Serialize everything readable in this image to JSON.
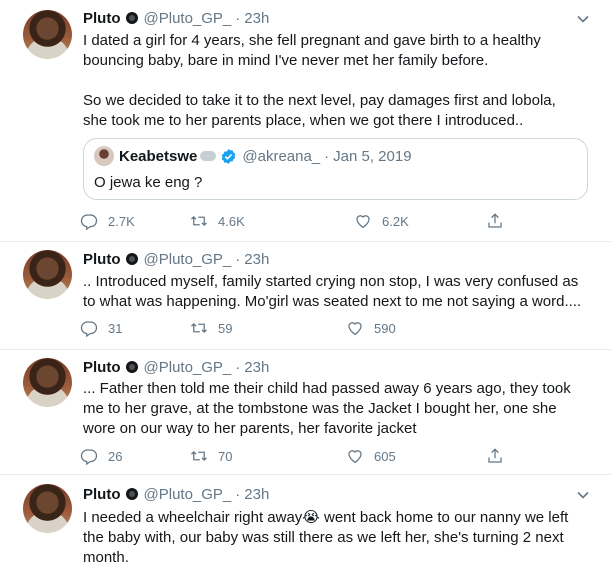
{
  "tweets": [
    {
      "author": "Pluto",
      "handle": "@Pluto_GP_",
      "time": "23h",
      "text": "I dated a girl for 4 years, she fell pregnant and gave birth to a healthy bouncing baby, bare in mind I've never met her family before.\n\nSo we decided to take it to the next level, pay damages first and lobola, she took me to her parents place, when we got there I introduced..",
      "quote": {
        "author": "Keabetswe",
        "handle": "@akreana_",
        "date": "Jan 5, 2019",
        "text": "O jewa ke eng ?"
      },
      "replies": "2.7K",
      "retweets": "4.6K",
      "likes": "6.2K"
    },
    {
      "author": "Pluto",
      "handle": "@Pluto_GP_",
      "time": "23h",
      "text": ".. Introduced myself, family started crying non stop, I was very confused as to what was happening. Mo'girl was seated next to me not saying a word....",
      "replies": "31",
      "retweets": "59",
      "likes": "590"
    },
    {
      "author": "Pluto",
      "handle": "@Pluto_GP_",
      "time": "23h",
      "text": "... Father then told me their child had passed away 6 years ago, they took me to her grave, at the tombstone was the Jacket I bought her, one she wore on our way to her parents, her favorite jacket",
      "replies": "26",
      "retweets": "70",
      "likes": "605"
    },
    {
      "author": "Pluto",
      "handle": "@Pluto_GP_",
      "time": "23h",
      "text": "I needed a wheelchair right away😭 went back home to our nanny we left the baby with, our baby was still there as we left her, she's turning 2 next month."
    }
  ],
  "sep": "·",
  "colors": {
    "text": "#14171a",
    "muted": "#657786",
    "divider": "#e6ecf0",
    "verified": "#1da1f2"
  },
  "icons": [
    "chevron-down-icon",
    "reply-icon",
    "retweet-icon",
    "like-icon",
    "share-icon",
    "verified-icon",
    "cloud-emoji-icon"
  ]
}
